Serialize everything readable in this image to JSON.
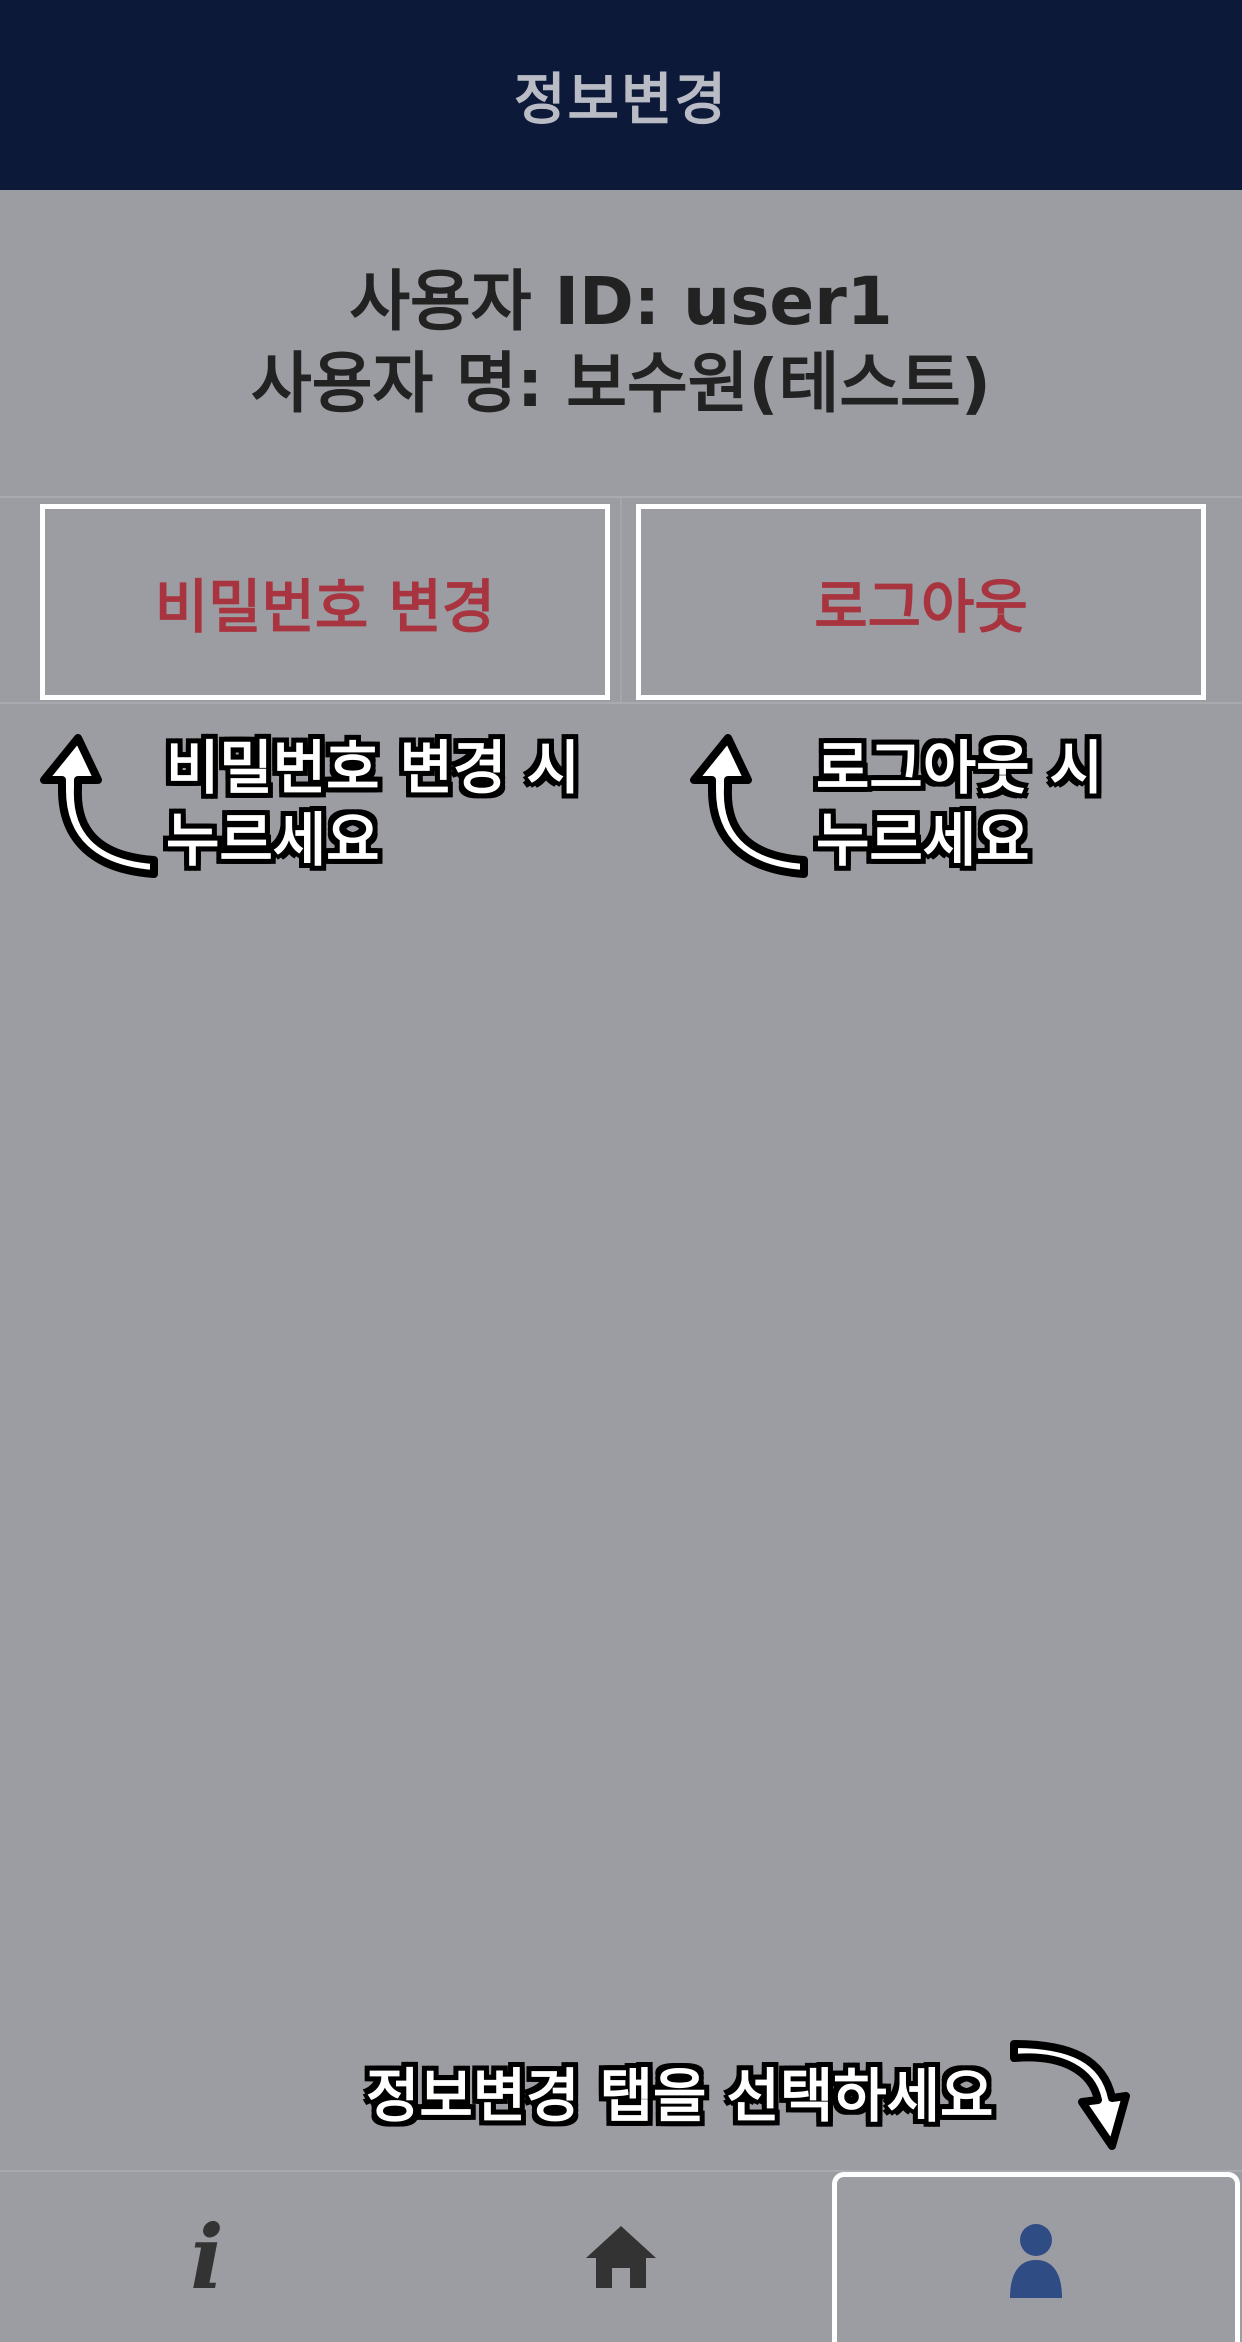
{
  "header": {
    "title": "정보변경"
  },
  "user": {
    "id_line": "사용자 ID: user1",
    "name_line": "사용자 명: 보수원(테스트)"
  },
  "actions": {
    "change_password": "비밀번호 변경",
    "logout": "로그아웃"
  },
  "hints": {
    "password_line1": "비밀번호 변경 시",
    "password_line2": "누르세요",
    "logout_line1": "로그아웃 시",
    "logout_line2": "누르세요",
    "tab_hint": "정보변경 탭을 선택하세요"
  },
  "tabs": [
    {
      "icon": "info-icon",
      "active": false
    },
    {
      "icon": "home-icon",
      "active": false
    },
    {
      "icon": "person-icon",
      "active": true
    }
  ],
  "colors": {
    "header_bg": "#0d1939",
    "page_bg": "#9c9da2",
    "action_text": "#a8343f",
    "active_tab_icon": "#2f4c85"
  }
}
